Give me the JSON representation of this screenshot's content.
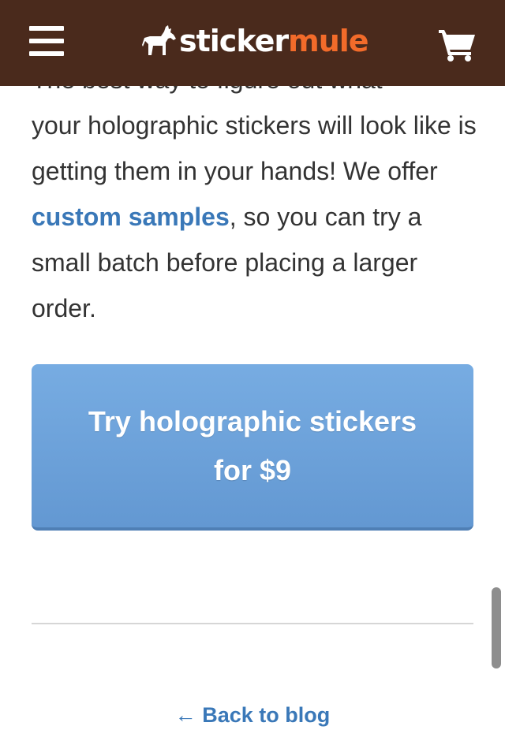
{
  "header": {
    "logo_prefix": "sticker",
    "logo_suffix": "mule",
    "colors": {
      "background": "#4a2a1c",
      "logo_accent": "#f26b2a"
    },
    "icons": [
      "menu-icon",
      "mule-icon",
      "cart-icon"
    ]
  },
  "article": {
    "clipped_line": "The best way to figure out what",
    "text_before_link": "your holographic stickers will look like is getting them in your hands! We offer ",
    "link_text": "custom samples",
    "text_after_link": ", so you can try a small batch before placing a larger order."
  },
  "cta": {
    "label": "Try holographic stickers for $9",
    "color": "#6a9fd8"
  },
  "footer": {
    "back_arrow": "←",
    "back_label": "Back to blog"
  }
}
